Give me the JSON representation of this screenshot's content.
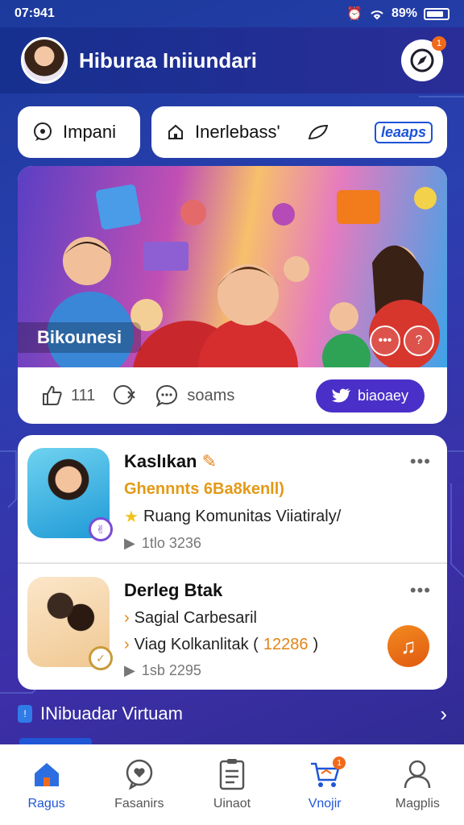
{
  "status_bar": {
    "time": "07:941",
    "battery": "89%"
  },
  "header": {
    "title": "Hiburaa Iniiundari",
    "badge": "1"
  },
  "chips": [
    {
      "label": "Impani",
      "icon": "chat-icon"
    },
    {
      "label": "Inerlebass'",
      "icon": "home-icon",
      "brand": "leaaps"
    }
  ],
  "hero": {
    "caption": "Bikounesi",
    "actions": {
      "like_count": "111",
      "share_icon": "share-icon",
      "comment_label": "soams",
      "primary_label": "biaoaey"
    }
  },
  "list": [
    {
      "title": "Kaslıkan",
      "sub": "Ghennnts 6Ba8kenll)",
      "line": "Ruang Komunitas Viiatiraly/",
      "meta": "1tlo  3236"
    },
    {
      "title": "Derleg Btak",
      "line1": "Sagial Carbesaril",
      "line2_prefix": "Viag Kolkanlitak (",
      "line2_number": "12286",
      "line2_suffix": ")",
      "meta": "1sb  2295"
    }
  ],
  "section": {
    "label": "INibuadar Virtuam"
  },
  "tabs": [
    {
      "label": "Ragus",
      "icon": "home-icon"
    },
    {
      "label": "Fasanirs",
      "icon": "heart-chat-icon"
    },
    {
      "label": "Uinaot",
      "icon": "document-icon"
    },
    {
      "label": "Vnojir",
      "icon": "cart-icon",
      "badge": "1"
    },
    {
      "label": "Magplis",
      "icon": "profile-icon"
    }
  ],
  "colors": {
    "accent": "#1f56d6",
    "primary_button": "#4a30c9",
    "highlight": "#e39a16"
  }
}
